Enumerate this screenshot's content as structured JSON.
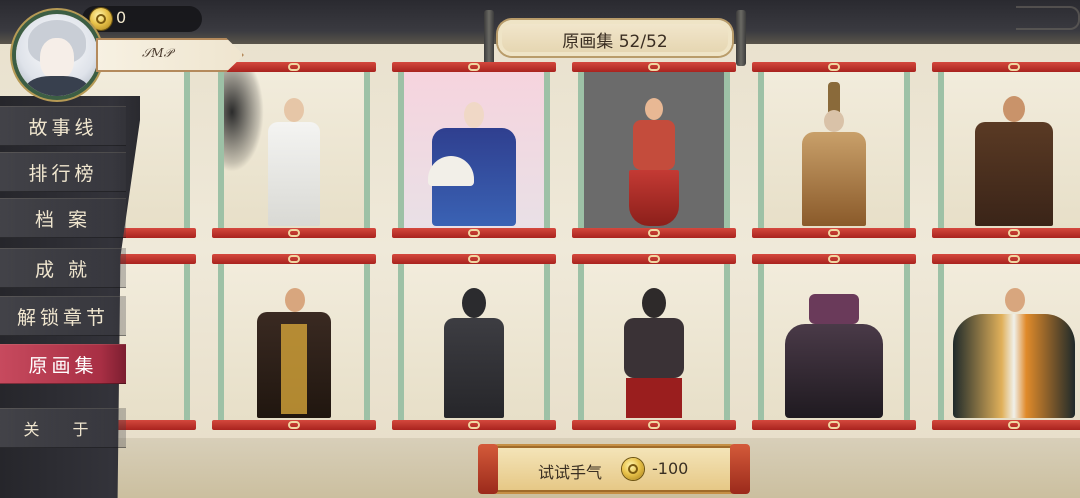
{
  "header": {
    "title": "原画集 52/52",
    "coins": "0",
    "player_name": "𝒮𝑀𝒫"
  },
  "menu": [
    {
      "label": "故事线",
      "active": false
    },
    {
      "label": "排行榜",
      "active": false
    },
    {
      "label": "档 案",
      "active": false
    },
    {
      "label": "成 就",
      "active": false
    },
    {
      "label": "解锁章节",
      "active": false
    },
    {
      "label": "原画集",
      "active": true
    },
    {
      "label": "关 于",
      "active": false
    }
  ],
  "gallery": {
    "cards": [
      {
        "id": "card-1",
        "subject": "monk in white robes"
      },
      {
        "id": "card-2",
        "subject": "noble with folding fan"
      },
      {
        "id": "card-3",
        "subject": "dancer in red"
      },
      {
        "id": "card-4",
        "subject": "elder with tall headdress"
      },
      {
        "id": "card-5",
        "subject": "man in brown robe"
      },
      {
        "id": "card-6",
        "subject": "warrior in black and gold"
      },
      {
        "id": "card-7",
        "subject": "masked assassin"
      },
      {
        "id": "card-8",
        "subject": "masked assassin in red"
      },
      {
        "id": "card-9",
        "subject": "dark robed figure"
      },
      {
        "id": "card-10",
        "subject": "swordsman in orange"
      }
    ]
  },
  "action": {
    "label": "试试手气",
    "cost": "-100"
  },
  "colors": {
    "accent_red": "#a82f44",
    "scroll_red": "#c33a30",
    "jade": "#9dc1a6"
  }
}
